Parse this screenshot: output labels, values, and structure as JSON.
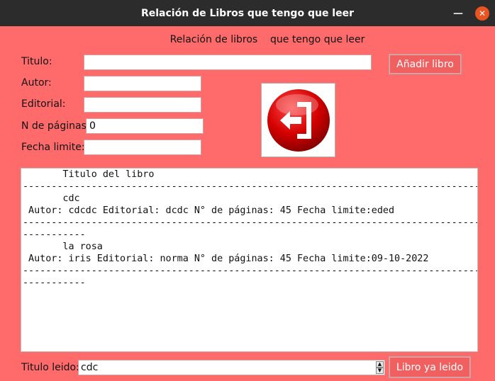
{
  "window": {
    "title": "Relación de Libros que tengo que leer"
  },
  "heading": "Relación de libros    que tengo que leer",
  "form": {
    "titulo_label": "Titulo:",
    "titulo_value": "",
    "autor_label": "Autor:",
    "autor_value": "",
    "editorial_label": "Editorial:",
    "editorial_value": "",
    "paginas_label": "N de páginas:",
    "paginas_value": "0",
    "fecha_label": "Fecha limite:",
    "fecha_value": ""
  },
  "buttons": {
    "add_label": "Añadir libro",
    "read_label": "Libro ya leido",
    "exit_icon": "exit-door-icon"
  },
  "list": {
    "lines": [
      "       Titulo del libro",
      "------------------------------------------------------------------------------------------------",
      "       cdc",
      " Autor: cdcdc Editorial: dcdc N° de páginas: 45 Fecha limite:eded",
      "------------------------------------------------------------------------------------------------",
      "-----------",
      "       la rosa",
      " Autor: iris Editorial: norma N° de páginas: 45 Fecha limite:09-10-2022",
      "------------------------------------------------------------------------------------------------",
      "-----------"
    ]
  },
  "read": {
    "label": "Titulo leido:",
    "value": "cdc"
  },
  "colors": {
    "background": "#ff6b6b",
    "titlebar": "#2c2c2c",
    "close": "#e95420",
    "exit_red": "#d40000"
  }
}
